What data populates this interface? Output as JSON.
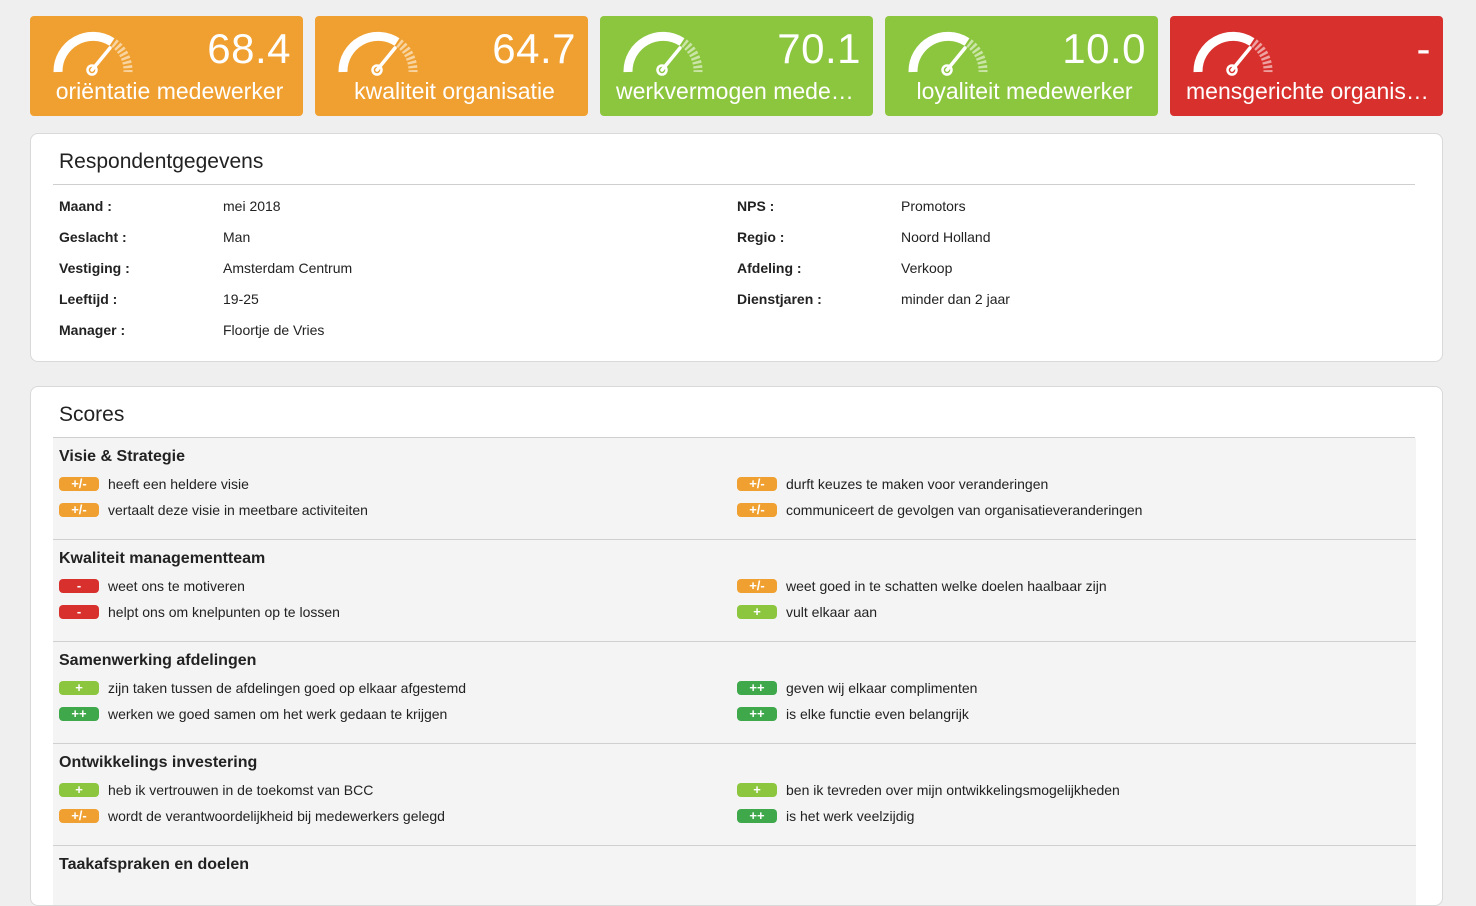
{
  "colors": {
    "orange": "#f0a030",
    "green": "#8cc63f",
    "red": "#d8302d",
    "dark_green": "#3ea84a"
  },
  "tiles": [
    {
      "value": "68.4",
      "label": "oriëntatie medewerker",
      "color": "#f0a030",
      "icon": "gauge-icon"
    },
    {
      "value": "64.7",
      "label": "kwaliteit organisatie",
      "color": "#f0a030",
      "icon": "gauge-icon"
    },
    {
      "value": "70.1",
      "label": "werkvermogen medewerker",
      "color": "#8cc63f",
      "icon": "gauge-icon"
    },
    {
      "value": "10.0",
      "label": "loyaliteit medewerker",
      "color": "#8cc63f",
      "icon": "gauge-icon"
    },
    {
      "value": "-",
      "label": "mensgerichte organisatie",
      "color": "#d8302d",
      "icon": "gauge-icon"
    }
  ],
  "respondent": {
    "title": "Respondentgegevens",
    "left": [
      {
        "key": "Maand :",
        "value": "mei 2018"
      },
      {
        "key": "Geslacht :",
        "value": "Man"
      },
      {
        "key": "Vestiging :",
        "value": "Amsterdam Centrum"
      },
      {
        "key": "Leeftijd :",
        "value": "19-25"
      },
      {
        "key": "Manager :",
        "value": "Floortje de Vries"
      }
    ],
    "right": [
      {
        "key": "NPS :",
        "value": "Promotors"
      },
      {
        "key": "Regio :",
        "value": "Noord Holland"
      },
      {
        "key": "Afdeling :",
        "value": "Verkoop"
      },
      {
        "key": "Dienstjaren :",
        "value": "minder dan 2 jaar"
      }
    ]
  },
  "scores": {
    "title": "Scores",
    "sections": [
      {
        "title": "Visie & Strategie",
        "left": [
          {
            "badge": "+/-",
            "kind": "neutral",
            "text": "heeft een heldere visie"
          },
          {
            "badge": "+/-",
            "kind": "neutral",
            "text": "vertaalt deze visie in meetbare activiteiten"
          }
        ],
        "right": [
          {
            "badge": "+/-",
            "kind": "neutral",
            "text": "durft keuzes te maken voor veranderingen"
          },
          {
            "badge": "+/-",
            "kind": "neutral",
            "text": "communiceert de gevolgen van organisatieveranderingen"
          }
        ]
      },
      {
        "title": "Kwaliteit managementteam",
        "left": [
          {
            "badge": "-",
            "kind": "negative",
            "text": "weet ons te motiveren"
          },
          {
            "badge": "-",
            "kind": "negative",
            "text": "helpt ons om knelpunten op te lossen"
          }
        ],
        "right": [
          {
            "badge": "+/-",
            "kind": "neutral",
            "text": "weet goed in te schatten welke doelen haalbaar zijn"
          },
          {
            "badge": "+",
            "kind": "positive",
            "text": "vult elkaar aan"
          }
        ]
      },
      {
        "title": "Samenwerking afdelingen",
        "left": [
          {
            "badge": "+",
            "kind": "positive",
            "text": "zijn taken tussen de afdelingen goed op elkaar afgestemd"
          },
          {
            "badge": "++",
            "kind": "very_positive",
            "text": "werken we goed samen om het werk gedaan te krijgen"
          }
        ],
        "right": [
          {
            "badge": "++",
            "kind": "very_positive",
            "text": "geven wij elkaar complimenten"
          },
          {
            "badge": "++",
            "kind": "very_positive",
            "text": "is elke functie even belangrijk"
          }
        ]
      },
      {
        "title": "Ontwikkelings investering",
        "left": [
          {
            "badge": "+",
            "kind": "positive",
            "text": "heb ik vertrouwen in de toekomst van BCC"
          },
          {
            "badge": "+/-",
            "kind": "neutral",
            "text": "wordt de verantwoordelijkheid bij medewerkers gelegd"
          }
        ],
        "right": [
          {
            "badge": "+",
            "kind": "positive",
            "text": "ben ik tevreden over mijn ontwikkelingsmogelijkheden"
          },
          {
            "badge": "++",
            "kind": "very_positive",
            "text": "is het werk veelzijdig"
          }
        ]
      },
      {
        "title": "Taakafspraken en doelen",
        "left": [],
        "right": []
      }
    ]
  }
}
